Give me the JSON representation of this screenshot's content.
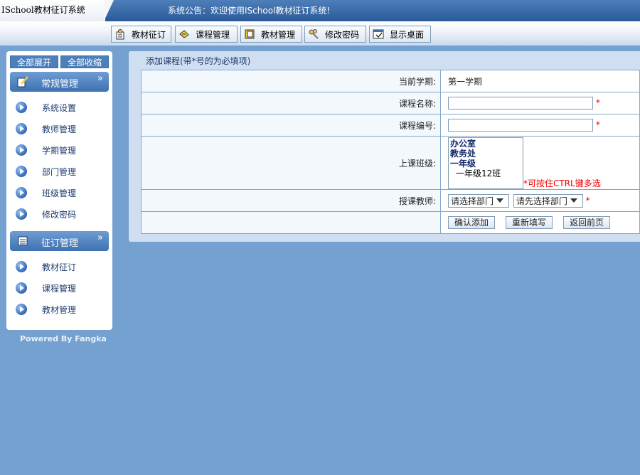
{
  "app": {
    "title": "ISchool教材征订系统",
    "notice": "系统公告：欢迎使用ISchool教材征订系统!"
  },
  "toolbar": [
    {
      "label": "教材征订",
      "icon": "book-order-icon"
    },
    {
      "label": "课程管理",
      "icon": "pencil-icon"
    },
    {
      "label": "教材管理",
      "icon": "book-icon"
    },
    {
      "label": "修改密码",
      "icon": "keys-icon"
    },
    {
      "label": "显示桌面",
      "icon": "desktop-icon"
    }
  ],
  "sidebar": {
    "expand_all": "全部展开",
    "collapse_all": "全部收缩",
    "sections": [
      {
        "title": "常规管理",
        "items": [
          "系统设置",
          "教师管理",
          "学期管理",
          "部门管理",
          "班级管理",
          "修改密码"
        ]
      },
      {
        "title": "征订管理",
        "items": [
          "教材征订",
          "课程管理",
          "教材管理"
        ]
      }
    ],
    "chevron": "»",
    "powered": "Powered By Fangka"
  },
  "form": {
    "title": "添加课程(带*号的为必填项)",
    "term_label": "当前学期:",
    "term_value": "第一学期",
    "name_label": "课程名称:",
    "name_value": "",
    "code_label": "课程编号:",
    "code_value": "",
    "required_mark": "*",
    "class_label": "上课班级:",
    "class_options": [
      {
        "text": "办公室",
        "group": true
      },
      {
        "text": "教务处",
        "group": true
      },
      {
        "text": "一年级",
        "group": true
      },
      {
        "text": "一年级12班",
        "group": false
      }
    ],
    "class_hint": "*可按住CTRL键多选",
    "teacher_label": "授课教师:",
    "dept_select": "请选择部门",
    "teacher_select": "请先选择部门",
    "buttons": {
      "confirm": "确认添加",
      "reset": "重新填写",
      "back": "返回前页"
    }
  },
  "colors": {
    "background": "#75a1d1",
    "topbar": "#2a5a98",
    "required": "#ee0000"
  }
}
